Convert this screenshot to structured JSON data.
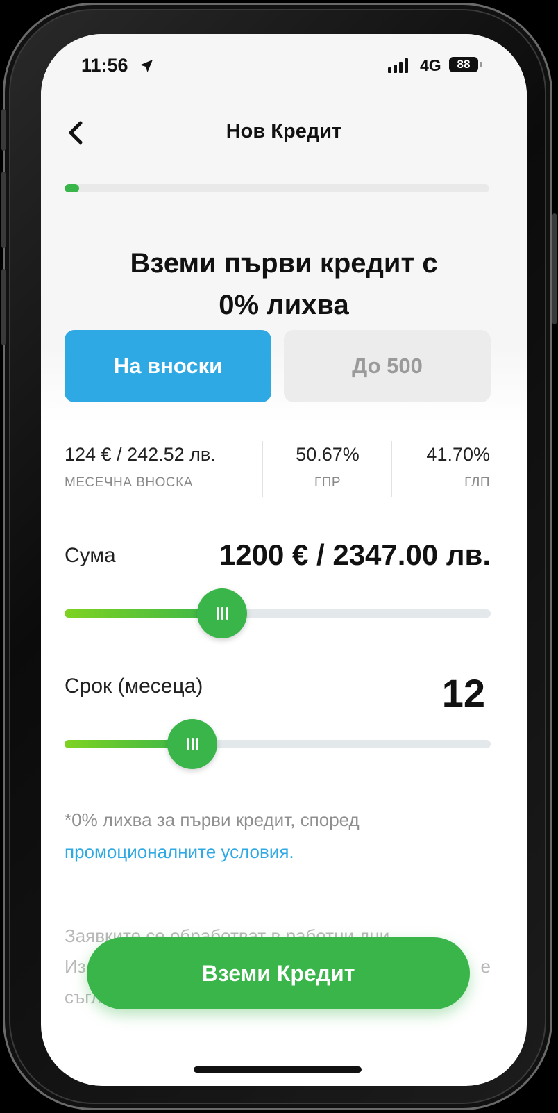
{
  "status_bar": {
    "time": "11:56",
    "network": "4G",
    "battery": "88",
    "icons": [
      "location-arrow-icon",
      "signal-icon",
      "battery-icon"
    ]
  },
  "header": {
    "title": "Нов Кредит",
    "back_icon": "chevron-left-icon"
  },
  "progress": {
    "value_percent": 3.5
  },
  "headline": {
    "line1": "Вземи първи кредит с",
    "line2_bold": "0%",
    "line2_rest": " лихва"
  },
  "tabs": [
    {
      "label": "На вноски",
      "active": true
    },
    {
      "label": "До 500",
      "active": false
    }
  ],
  "stats": [
    {
      "value": "124 € / 242.52 лв.",
      "label": "МЕСЕЧНА ВНОСКА"
    },
    {
      "value": "50.67%",
      "label": "ГПР"
    },
    {
      "value": "41.70%",
      "label": "ГЛП"
    }
  ],
  "amount": {
    "label": "Сума",
    "value": "1200 € / 2347.00 лв.",
    "slider_fraction": 0.37
  },
  "term": {
    "label": "Срок (месеца)",
    "value": "12",
    "slider_fraction": 0.3
  },
  "note": {
    "text": "*0% лихва за първи кредит, според ",
    "link": "промоционалните условия."
  },
  "footer": {
    "line1": "Заявките се обработват в работни дни.",
    "line2_start": "Из",
    "line2_end": "е",
    "line3_start": "съгл"
  },
  "cta": {
    "label": "Вземи Кредит"
  },
  "colors": {
    "accent_green": "#39b54a",
    "accent_blue": "#2ea9e4",
    "slider_gradient_start": "#7ed321"
  }
}
